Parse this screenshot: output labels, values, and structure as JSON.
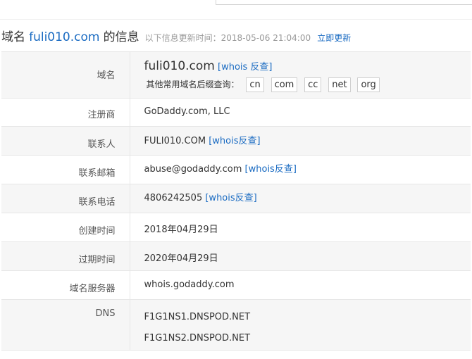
{
  "heading": {
    "prefix": "域名",
    "domain": "fuli010.com",
    "suffix": "的信息",
    "update_note": "以下信息更新时间：2018-05-06 21:04:00",
    "update_link": "立即更新"
  },
  "rows": {
    "domain": {
      "label": "域名",
      "value": "fuli010.com",
      "whois_link": "[whois 反查]",
      "suffix_prompt": "其他常用域名后缀查询：",
      "suffixes": [
        "cn",
        "com",
        "cc",
        "net",
        "org"
      ]
    },
    "registrar": {
      "label": "注册商",
      "value": "GoDaddy.com, LLC"
    },
    "contact": {
      "label": "联系人",
      "value": "FULI010.COM",
      "whois_link": "[whois反查]"
    },
    "email": {
      "label": "联系邮箱",
      "value": "abuse@godaddy.com",
      "whois_link": "[whois反查]"
    },
    "phone": {
      "label": "联系电话",
      "value": "4806242505",
      "whois_link": "[whois反查]"
    },
    "created": {
      "label": "创建时间",
      "value": "2018年04月29日"
    },
    "expires": {
      "label": "过期时间",
      "value": "2020年04月29日"
    },
    "whois_server": {
      "label": "域名服务器",
      "value": "whois.godaddy.com"
    },
    "dns": {
      "label": "DNS",
      "values": [
        "F1G1NS1.DNSPOD.NET",
        "F1G1NS2.DNSPOD.NET"
      ]
    }
  },
  "colors": {
    "link": "#1a6bc2",
    "row_shade": "#f6f6f6",
    "border": "#e6e6e6"
  }
}
